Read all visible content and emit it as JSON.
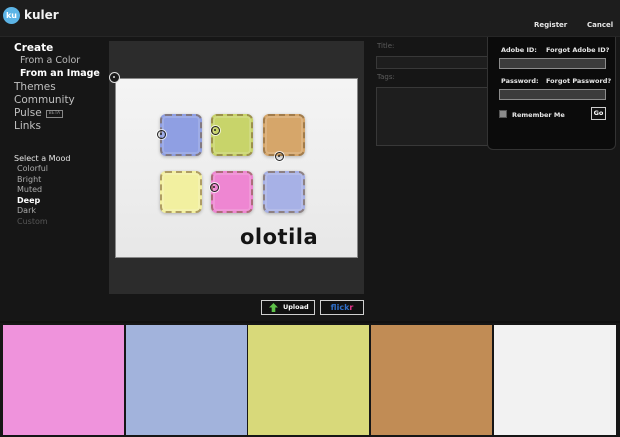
{
  "header": {
    "logo_badge": "ku",
    "logo_text": "kuler",
    "register": "Register",
    "cancel": "Cancel"
  },
  "nav": {
    "create": "Create",
    "from_color": "From a Color",
    "from_image": "From an Image",
    "themes": "Themes",
    "community": "Community",
    "pulse": "Pulse",
    "pulse_badge": "BETA",
    "links": "Links"
  },
  "mood": {
    "title": "Select a Mood",
    "options": [
      "Colorful",
      "Bright",
      "Muted",
      "Deep",
      "Dark",
      "Custom"
    ],
    "selected": "Deep"
  },
  "image": {
    "watermark": "olotila"
  },
  "buttons": {
    "upload": "Upload",
    "flickr_part1": "flick",
    "flickr_part2": "r"
  },
  "theme_fields": {
    "title_label": "Title:",
    "tags_label": "Tags:"
  },
  "login": {
    "adobe_id_label": "Adobe ID:",
    "forgot_id": "Forgot Adobe ID?",
    "password_label": "Password:",
    "forgot_password": "Forgot Password?",
    "remember_me": "Remember Me",
    "go": "Go"
  },
  "colors": {
    "swatch_1": "#ef93dc",
    "swatch_2": "#a2b3dc",
    "swatch_3": "#d8d97a",
    "swatch_4": "#c18c55",
    "swatch_5": "#f2f2f2",
    "accent_logo": "#5cb4e6",
    "cookie_blue": "#8f9fe3",
    "cookie_green": "#c8d46a",
    "cookie_orange": "#d6a66a",
    "cookie_yellow": "#f2f0a0",
    "cookie_pink": "#ee86d2",
    "cookie_lavender": "#a7b1e6"
  }
}
